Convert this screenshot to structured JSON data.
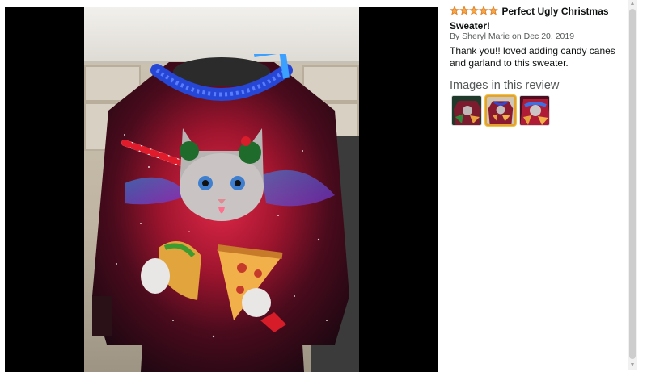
{
  "review": {
    "rating": 5,
    "rating_max": 5,
    "title": "Perfect Ugly Christmas Sweater!",
    "byline": "By Sheryl Marie on Dec 20, 2019",
    "body": "Thank you!! loved adding candy canes and garland to this sweater.",
    "images_heading": "Images in this review"
  },
  "colors": {
    "star": "#f3a847",
    "star_outline": "#de7921",
    "selected_thumb_border": "#e3a32c",
    "media_background": "#000000"
  },
  "thumbnails": [
    {
      "name": "thumb-1",
      "selected": false
    },
    {
      "name": "thumb-2",
      "selected": true
    },
    {
      "name": "thumb-3",
      "selected": false
    }
  ]
}
